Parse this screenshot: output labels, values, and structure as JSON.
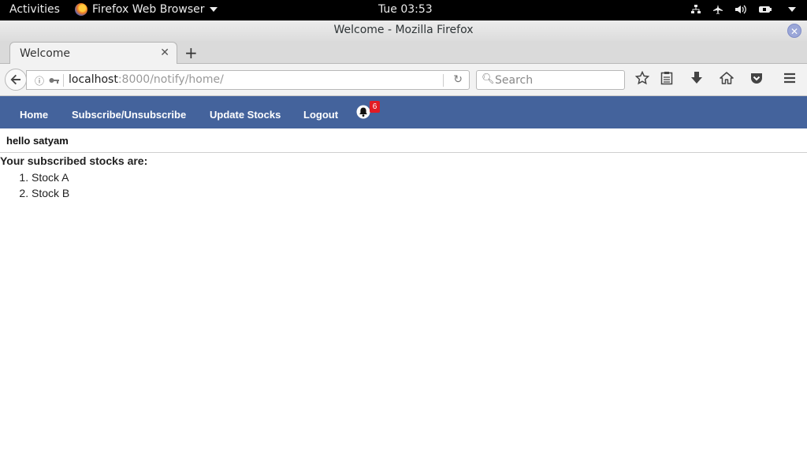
{
  "system": {
    "activities": "Activities",
    "app_name": "Firefox Web Browser",
    "clock": "Tue 03:53"
  },
  "window": {
    "title": "Welcome - Mozilla Firefox"
  },
  "tabs": [
    {
      "label": "Welcome",
      "active": true
    }
  ],
  "navbar": {
    "url_host": "localhost",
    "url_rest": ":8000/notify/home/",
    "search_placeholder": "Search"
  },
  "site": {
    "nav": [
      {
        "label": "Home"
      },
      {
        "label": "Subscribe/Unsubscribe"
      },
      {
        "label": "Update Stocks"
      },
      {
        "label": "Logout"
      }
    ],
    "notification_count": "6",
    "greeting": "hello satyam",
    "subscribed_heading": "Your subscribed stocks are:",
    "stocks": [
      "Stock A",
      "Stock B"
    ]
  },
  "colors": {
    "site_nav_bg": "#44639c",
    "badge_bg": "#e21b24"
  }
}
